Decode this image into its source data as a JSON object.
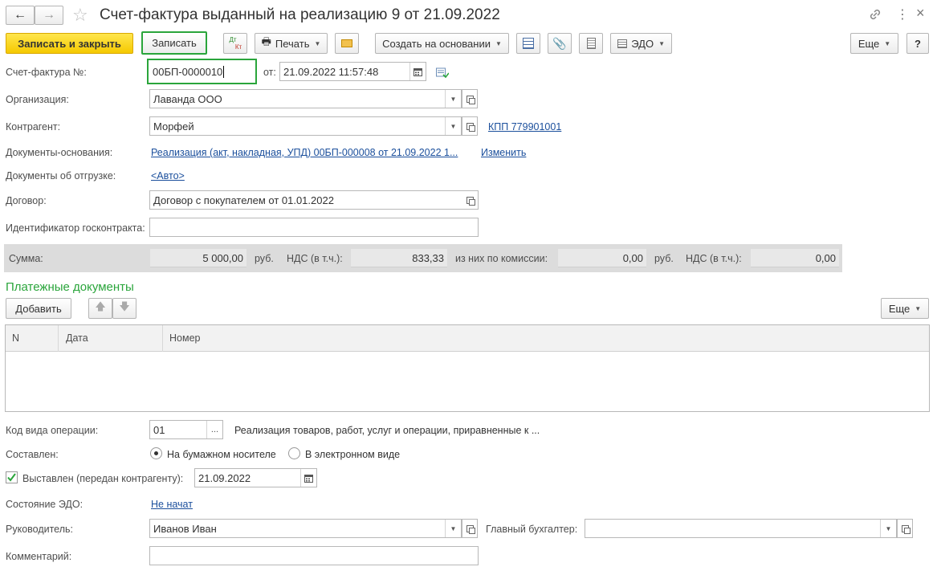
{
  "header": {
    "title": "Счет-фактура выданный на реализацию 9 от 21.09.2022",
    "back_glyph": "←",
    "forward_glyph": "→"
  },
  "toolbar": {
    "save_close": "Записать и закрыть",
    "save": "Записать",
    "dt_kt_top": "Дт",
    "dt_kt_bottom": "Кт",
    "print": "Печать",
    "create_basis": "Создать на основании",
    "edo": "ЭДО",
    "more": "Еще",
    "help": "?"
  },
  "form": {
    "invoice_number_label": "Счет-фактура №:",
    "invoice_number": "00БП-0000010",
    "date_from_label": "от:",
    "date": "21.09.2022 11:57:48",
    "organization_label": "Организация:",
    "organization": "Лаванда ООО",
    "counterparty_label": "Контрагент:",
    "counterparty": "Морфей",
    "kpp_link": "КПП 779901001",
    "basis_docs_label": "Документы-основания:",
    "basis_docs_link": "Реализация (акт, накладная, УПД) 00БП-000008 от 21.09.2022 1...",
    "change_link": "Изменить",
    "shipping_docs_label": "Документы об отгрузке:",
    "shipping_docs_link": "<Авто>",
    "contract_label": "Договор:",
    "contract": "Договор с покупателем от 01.01.2022",
    "gov_contract_label": "Идентификатор госконтракта:",
    "gov_contract": ""
  },
  "sums": {
    "sum_label": "Сумма:",
    "sum_value": "5 000,00",
    "currency1": "руб.",
    "vat_label1": "НДС (в т.ч.):",
    "vat_value1": "833,33",
    "commission_label": "из них по комиссии:",
    "commission_value": "0,00",
    "currency2": "руб.",
    "vat_label2": "НДС (в т.ч.):",
    "vat_value2": "0,00"
  },
  "payments": {
    "title": "Платежные документы",
    "add": "Добавить",
    "more": "Еще",
    "columns": [
      "N",
      "Дата",
      "Номер"
    ]
  },
  "bottom": {
    "op_code_label": "Код вида операции:",
    "op_code": "01",
    "op_code_select": "...",
    "op_code_desc": "Реализация товаров, работ, услуг и операции, приравненные к ...",
    "composed_label": "Составлен:",
    "paper_option": "На бумажном носителе",
    "electronic_option": "В электронном виде",
    "issued_label": "Выставлен (передан контрагенту):",
    "issued_date": "21.09.2022",
    "edo_state_label": "Состояние ЭДО:",
    "edo_state_link": "Не начат",
    "head_label": "Руководитель:",
    "head": "Иванов Иван",
    "chief_accountant_label": "Главный бухгалтер:",
    "chief_accountant": "",
    "comment_label": "Комментарий:",
    "comment": ""
  },
  "colors": {
    "accent_green": "#2aa53b",
    "link_blue": "#1b4f9c",
    "primary_yellow": "#f5c900"
  }
}
